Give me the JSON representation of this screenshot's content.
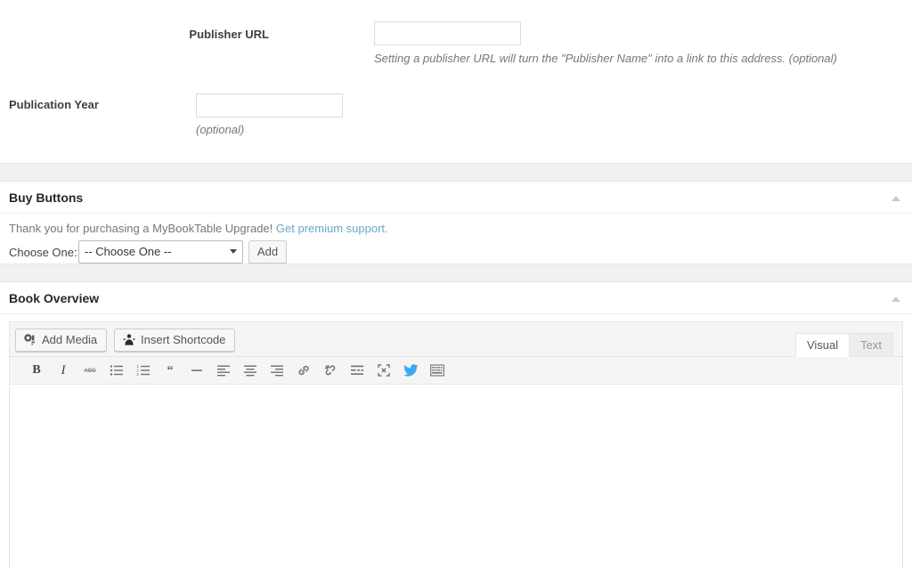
{
  "form": {
    "fields": [
      {
        "label": "Publisher URL",
        "value": "",
        "placeholder": "",
        "hint": "Setting a publisher URL will turn the \"Publisher Name\" into a link to this address. (optional)"
      },
      {
        "label": "Publication Year",
        "value": "",
        "placeholder": "",
        "hint": "(optional)"
      }
    ]
  },
  "buy_buttons": {
    "title": "Buy Buttons",
    "toggle_icon": "chevron-up-icon",
    "notice_text": "Thank you for purchasing a MyBookTable Upgrade!",
    "notice_link": "Get premium support.",
    "notice_link_color": "#6aa8c9",
    "choose_label": "Choose One:",
    "select_value": "-- Choose One --",
    "select_options": [
      "-- Choose One --"
    ],
    "add_label": "Add"
  },
  "book_overview": {
    "title": "Book Overview",
    "toggle_icon": "chevron-up-icon",
    "add_media_label": "Add Media",
    "add_media_icon": "media-camera-icon",
    "insert_shortcode_label": "Insert Shortcode",
    "insert_shortcode_icon": "shortcode-icon",
    "tabs": [
      {
        "label": "Visual",
        "active": true
      },
      {
        "label": "Text",
        "active": false
      }
    ],
    "toolbar": [
      {
        "name": "bold-icon",
        "title": "Bold",
        "glyph": "B"
      },
      {
        "name": "italic-icon",
        "title": "Italic",
        "glyph": "I"
      },
      {
        "name": "strikethrough-icon",
        "title": "Strikethrough",
        "glyph": "ABC"
      },
      {
        "name": "bulleted-list-icon",
        "title": "Bulleted list",
        "glyph": ""
      },
      {
        "name": "numbered-list-icon",
        "title": "Numbered list",
        "glyph": ""
      },
      {
        "name": "blockquote-icon",
        "title": "Blockquote",
        "glyph": ""
      },
      {
        "name": "horizontal-rule-icon",
        "title": "Horizontal line",
        "glyph": ""
      },
      {
        "name": "align-left-icon",
        "title": "Align left",
        "glyph": ""
      },
      {
        "name": "align-center-icon",
        "title": "Align center",
        "glyph": ""
      },
      {
        "name": "align-right-icon",
        "title": "Align right",
        "glyph": ""
      },
      {
        "name": "insert-link-icon",
        "title": "Insert/edit link",
        "glyph": ""
      },
      {
        "name": "unlink-icon",
        "title": "Remove link",
        "glyph": ""
      },
      {
        "name": "read-more-icon",
        "title": "Insert Read More tag",
        "glyph": ""
      },
      {
        "name": "fullscreen-icon",
        "title": "Distraction-free writing mode",
        "glyph": ""
      },
      {
        "name": "twitter-icon",
        "title": "Twitter",
        "glyph": "",
        "color": "#3ba9f2"
      },
      {
        "name": "toolbar-toggle-icon",
        "title": "Toolbar Toggle",
        "glyph": ""
      }
    ],
    "content": ""
  }
}
